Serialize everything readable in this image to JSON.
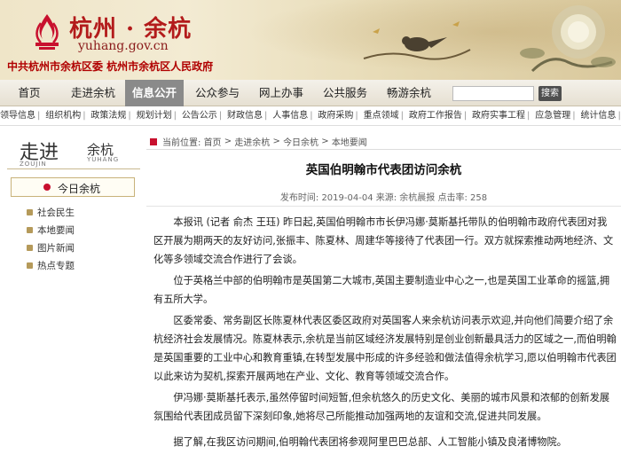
{
  "header": {
    "logo_cn": "杭州 · 余杭",
    "logo_url": "yuhang.gov.cn",
    "gov_line": "中共杭州市余杭区委 杭州市余杭区人民政府"
  },
  "main_nav": {
    "items": [
      "首页",
      "走进余杭",
      "信息公开",
      "公众参与",
      "网上办事",
      "公共服务",
      "畅游余杭"
    ],
    "active_index": 2,
    "search_button": "搜索"
  },
  "sub_nav": [
    "领导信息",
    "组织机构",
    "政策法规",
    "规划计划",
    "公告公示",
    "财政信息",
    "人事信息",
    "政府采购",
    "重点领域",
    "政府工作报告",
    "政府实事工程",
    "应急管理",
    "统计信息",
    ">>"
  ],
  "sidebar": {
    "head_big": "走进",
    "head_small": "余杭",
    "head_en1": "ZOUJIN",
    "head_en2": "YUHANG",
    "today": "今日余杭",
    "items": [
      "社会民生",
      "本地要闻",
      "图片新闻",
      "热点专题"
    ]
  },
  "breadcrumb": {
    "prefix": "当前位置:",
    "items": [
      "首页",
      "走进余杭",
      "今日余杭",
      "本地要闻"
    ],
    "separator": " > "
  },
  "article": {
    "title": "英国伯明翰市代表团访问余杭",
    "meta": "发布时间: 2019-04-04 来源: 余杭晨报 点击率: 258",
    "paragraphs": [
      "本报讯 (记者 俞杰 王珏) 昨日起,英国伯明翰市市长伊冯娜·莫斯基托带队的伯明翰市政府代表团对我区开展为期两天的友好访问,张振丰、陈夏林、周建华等接待了代表团一行。双方就探索推动两地经济、文化等多领域交流合作进行了会谈。",
      "位于英格兰中部的伯明翰市是英国第二大城市,英国主要制造业中心之一,也是英国工业革命的摇篮,拥有五所大学。",
      "区委常委、常务副区长陈夏林代表区委区政府对英国客人来余杭访问表示欢迎,并向他们简要介绍了余杭经济社会发展情况。陈夏林表示,余杭是当前区域经济发展特别是创业创新最具活力的区域之一,而伯明翰是英国重要的工业中心和教育重镇,在转型发展中形成的许多经验和做法值得余杭学习,愿以伯明翰市代表团以此来访为契机,探索开展两地在产业、文化、教育等领域交流合作。",
      "伊冯娜·莫斯基托表示,虽然停留时间短暂,但余杭悠久的历史文化、美丽的城市风景和浓郁的创新发展氛围给代表团成员留下深刻印象,她将尽己所能推动加强两地的友谊和交流,促进共同发展。",
      "据了解,在我区访问期间,伯明翰代表团将参观阿里巴巴总部、人工智能小镇及良渚博物院。"
    ]
  },
  "colors": {
    "brand_red": "#b31b1b",
    "nav_active": "#8a8a8a",
    "accent_gold": "#b59a5a"
  }
}
